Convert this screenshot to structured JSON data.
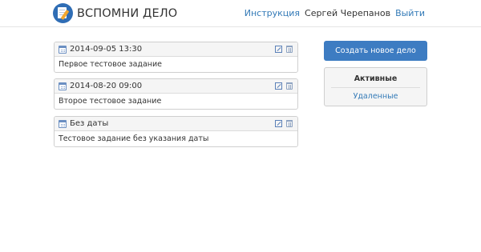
{
  "header": {
    "brand": "ВСПОМНИ ДЕЛО",
    "links": {
      "instructions": "Инструкция",
      "user": "Сергей Черепанов",
      "logout": "Выйти"
    }
  },
  "tasks": [
    {
      "date": "2014-09-05 13:30",
      "text": "Первое тестовое задание"
    },
    {
      "date": "2014-08-20 09:00",
      "text": "Второе тестовое задание"
    },
    {
      "date": "Без даты",
      "text": "Тестовое задание без указания даты"
    }
  ],
  "sidebar": {
    "create_label": "Создать новое дело",
    "filter_active": "Активные",
    "filter_deleted": "Удаленные"
  },
  "colors": {
    "primary": "#3d7cc2",
    "link": "#337ab7"
  },
  "icons": {
    "logo": "notepad-pencil-icon",
    "date": "calendar-icon",
    "edit": "edit-icon",
    "delete": "trash-icon"
  }
}
